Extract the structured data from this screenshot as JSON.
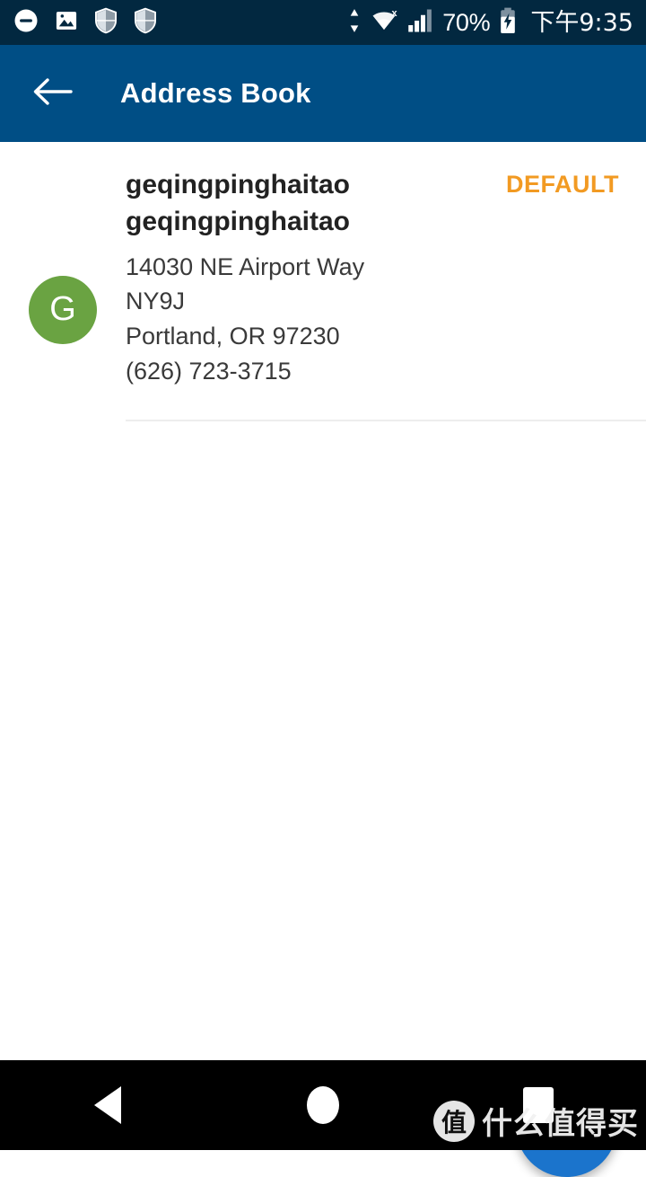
{
  "status_bar": {
    "background_color": "#022840",
    "left_icons": [
      {
        "name": "do-not-disturb-icon",
        "glyph": "minus-circle"
      },
      {
        "name": "image-icon",
        "glyph": "photo"
      },
      {
        "name": "shield-icon-1",
        "glyph": "shield"
      },
      {
        "name": "shield-icon-2",
        "glyph": "shield"
      }
    ],
    "right_icons": [
      {
        "name": "data-transfer-icon",
        "glyph": "up-down-arrows"
      },
      {
        "name": "wifi-disconnected-icon",
        "glyph": "wifi-x"
      },
      {
        "name": "cell-signal-icon",
        "glyph": "signal-bars"
      }
    ],
    "battery_percent": "70%",
    "battery_icon": "battery-charging-icon",
    "clock": "下午9:35"
  },
  "app_bar": {
    "background_color": "#004E85",
    "back_icon": "back-arrow-icon",
    "title": "Address Book"
  },
  "address_list": [
    {
      "avatar_initial": "G",
      "avatar_color": "#6AA342",
      "name": "geqingpinghaitao geqingpinghaitao",
      "address_lines": [
        "14030 NE Airport Way",
        "NY9J",
        "Portland, OR 97230",
        "(626) 723-3715"
      ],
      "badge": "DEFAULT",
      "badge_color": "#F29A22"
    }
  ],
  "fab": {
    "name": "add-address-button",
    "icon": "plus-icon",
    "color": "#1B74CC"
  },
  "nav_bar": {
    "background_color": "#000000",
    "buttons": [
      {
        "name": "nav-back-button",
        "icon": "triangle-back-icon"
      },
      {
        "name": "nav-home-button",
        "icon": "circle-home-icon"
      },
      {
        "name": "nav-recents-button",
        "icon": "square-recents-icon"
      }
    ]
  },
  "watermark": {
    "logo_text": "值",
    "text": "什么值得买"
  }
}
